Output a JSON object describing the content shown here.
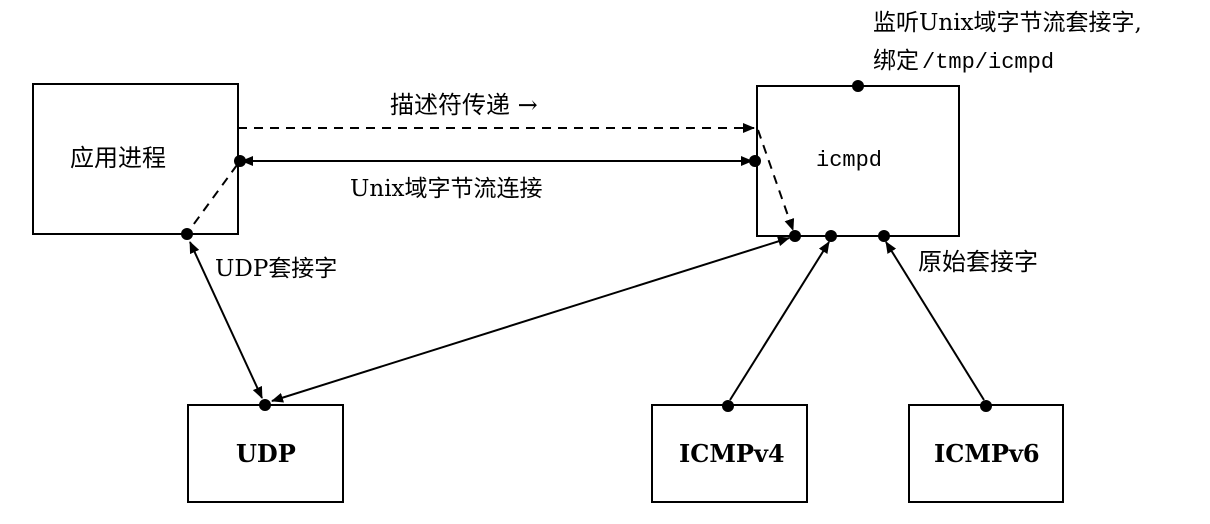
{
  "boxes": {
    "app_process": "应用进程",
    "icmpd": "icmpd",
    "udp": "UDP",
    "icmpv4": "ICMPv4",
    "icmpv6": "ICMPv6"
  },
  "labels": {
    "descriptor_passing": "描述符传递 →",
    "unix_stream_connection": "Unix域字节流连接",
    "udp_socket": "UDP套接字",
    "raw_socket": "原始套接字",
    "listen_line1": "监听Unix域字节流套接字,",
    "listen_line2_prefix": "绑定",
    "listen_line2_path": "/tmp/icmpd"
  }
}
